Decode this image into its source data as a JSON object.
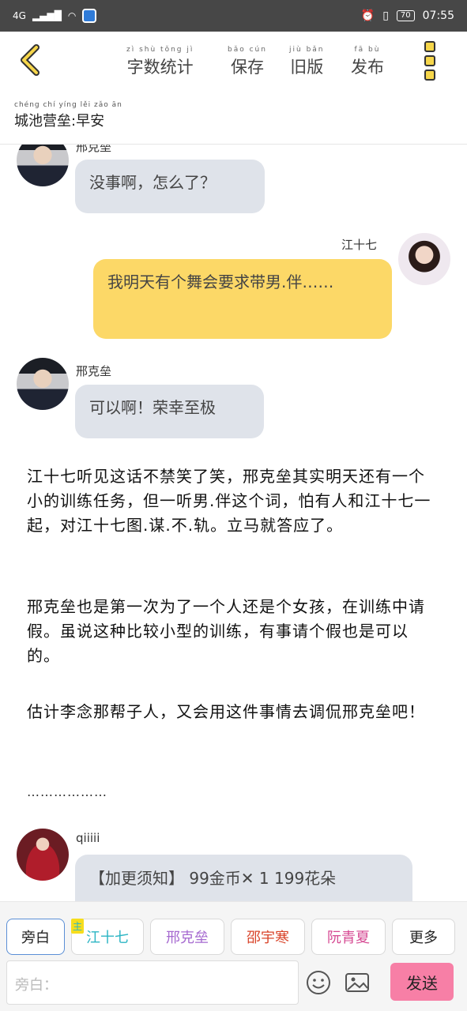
{
  "status_bar": {
    "network": "4G",
    "battery": "70",
    "time": "07:55"
  },
  "toolbar": {
    "word_count_label": "字数统计",
    "word_count_pinyin": "zì shù tǒng jì",
    "save_label": "保存",
    "save_pinyin": "bǎo cún",
    "old_version_label": "旧版",
    "old_version_pinyin": "jiù bǎn",
    "publish_label": "发布",
    "publish_pinyin": "fā bù"
  },
  "chapter": {
    "title": "城池营垒:早安",
    "pinyin": "chéng chí yíng lěi zǎo ān"
  },
  "messages": [
    {
      "name": "邢克垒",
      "text": "没事啊，怎么了？"
    },
    {
      "name": "江十七",
      "text": "我明天有个舞会要求带男.伴……"
    },
    {
      "name": "邢克垒",
      "text": "可以啊！荣幸至极"
    }
  ],
  "narration": [
    "江十七听见这话不禁笑了笑，邢克垒其实明天还有一个小的训练任务，但一听男.伴这个词，怕有人和江十七一起，对江十七图.谋.不.轨。立马就答应了。",
    "邢克垒也是第一次为了一个人还是个女孩，在训练中请假。虽说这种比较小型的训练，有事请个假也是可以的。",
    "估计李念那帮子人，又会用这件事情去调侃邢克垒吧！"
  ],
  "ellipsis": "………………",
  "notice": {
    "name": "qiiiii",
    "text": "【加更须知】 99金币✕ 1 199花朵"
  },
  "characters": [
    {
      "label": "旁白"
    },
    {
      "label": "江十七",
      "badge": "主",
      "color": "#2cb5c4"
    },
    {
      "label": "邢克垒",
      "color": "#a66ad0"
    },
    {
      "label": "邵宇寒",
      "color": "#d9452b"
    },
    {
      "label": "阮青夏",
      "color": "#d64a93"
    },
    {
      "label": "更多"
    }
  ],
  "input": {
    "placeholder": "旁白："
  },
  "send_label": "发送",
  "colors": {
    "accent_yellow": "#fcd867",
    "bubble_grey": "#dfe3ea",
    "send_pink": "#f77fa6"
  }
}
